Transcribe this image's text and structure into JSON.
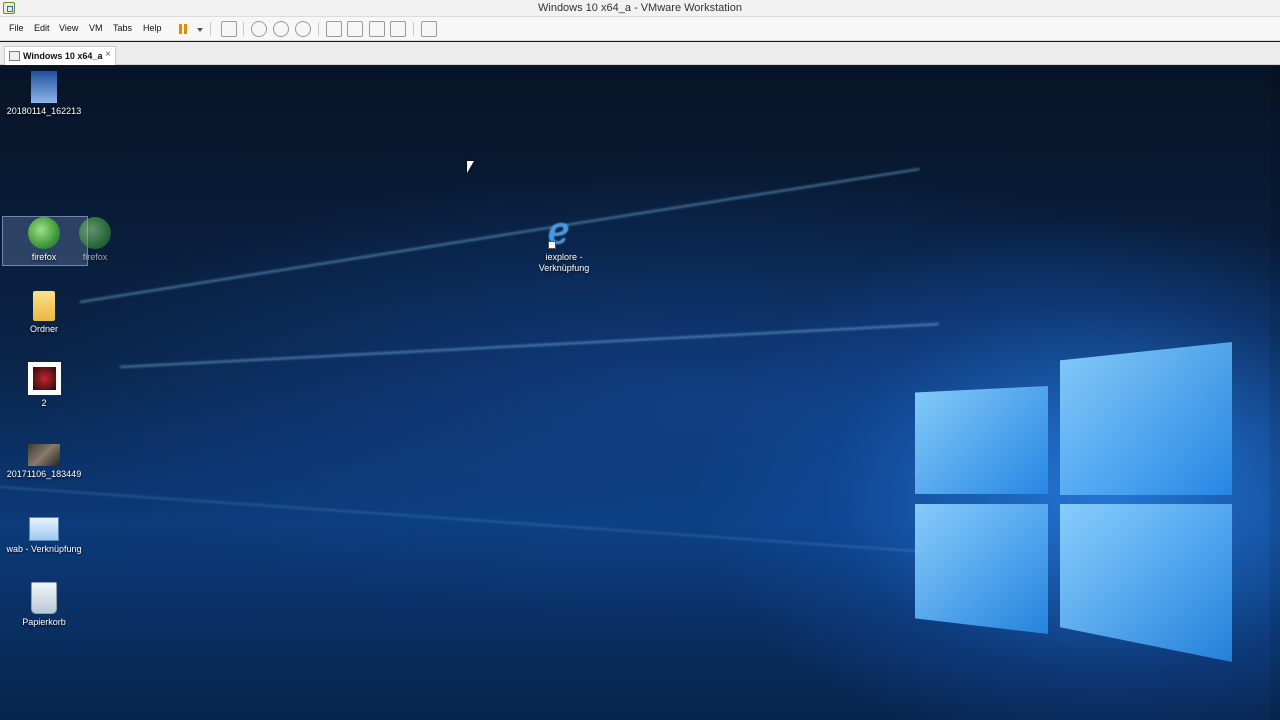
{
  "window": {
    "title": "Windows 10 x64_a - VMware Workstation"
  },
  "menu": {
    "items": [
      "File",
      "Edit",
      "View",
      "VM",
      "Tabs",
      "Help"
    ]
  },
  "toolbar": {
    "icons": [
      "pause-icon",
      "dropdown-icon",
      "send-ctrl-alt-del-icon",
      "snapshot-icon",
      "revert-snapshot-icon",
      "snapshot-manager-icon",
      "library-icon",
      "thumbnail-icon",
      "full-screen-icon",
      "unity-icon",
      "console-view-icon"
    ]
  },
  "tabs": [
    {
      "label": "Windows 10 x64_a",
      "close": "×"
    }
  ],
  "desktop": {
    "icons": [
      {
        "label": "20180114_162213",
        "icon": "image-file-icon"
      },
      {
        "label": "firefox",
        "icon": "firefox-icon"
      },
      {
        "label": "firefox",
        "icon": "firefox-icon"
      },
      {
        "label": "iexplore -\nVerknüpfung",
        "label_line1": "iexplore -",
        "label_line2": "Verknüpfung",
        "icon": "internet-explorer-icon"
      },
      {
        "label": "Ordner",
        "icon": "folder-icon"
      },
      {
        "label": "2",
        "icon": "image-file-icon"
      },
      {
        "label": "20171106_183449",
        "icon": "image-file-icon"
      },
      {
        "label": "wab - Verknüpfung",
        "icon": "contacts-shortcut-icon"
      },
      {
        "label": "Papierkorb",
        "icon": "recycle-bin-icon"
      }
    ]
  },
  "colors": {
    "accent": "#2b8be6",
    "pause": "#e58a00"
  }
}
